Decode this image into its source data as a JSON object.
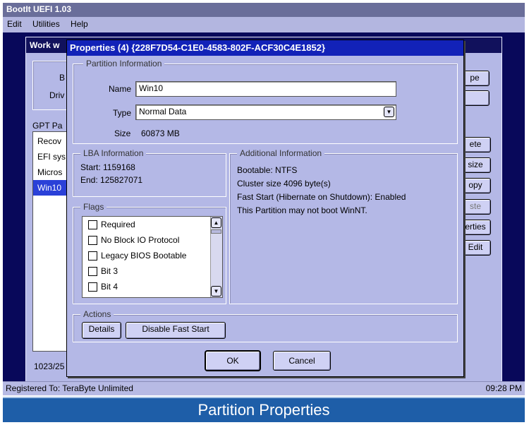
{
  "app": {
    "title": "BootIt UEFI 1.03",
    "menu": [
      "Edit",
      "Utilities",
      "Help"
    ]
  },
  "background": {
    "work_title": "Work w",
    "labels": [
      "B",
      "Driv"
    ],
    "gpt_label": "GPT Pa",
    "partitions": [
      "Recov",
      "EFI sys",
      "Micros",
      "Win10"
    ],
    "bottom_text": "1023/25",
    "right_buttons": [
      "pe",
      "",
      "ete",
      "size",
      "opy",
      "ste",
      "erties",
      "Edit"
    ]
  },
  "dialog": {
    "title": "Properties (4) {228F7D54-C1E0-4583-802F-ACF30C4E1852}",
    "partition_info_legend": "Partition Information",
    "name_label": "Name",
    "name_value": "Win10",
    "type_label": "Type",
    "type_value": "Normal Data",
    "size_label": "Size",
    "size_value": "60873 MB",
    "lba_legend": "LBA Information",
    "lba_start": "Start: 1159168",
    "lba_end": "End: 125827071",
    "additional_legend": "Additional Information",
    "additional_lines": [
      "Bootable: NTFS",
      "Cluster size 4096 byte(s)",
      "Fast Start (Hibernate on Shutdown): Enabled",
      "This Partition may not boot WinNT."
    ],
    "flags_legend": "Flags",
    "flags": [
      "Required",
      "No Block IO Protocol",
      "Legacy BIOS Bootable",
      "Bit 3",
      "Bit 4"
    ],
    "actions_legend": "Actions",
    "details_button": "Details",
    "disable_fast_start_button": "Disable Fast Start",
    "ok_button": "OK",
    "cancel_button": "Cancel"
  },
  "status_bar": {
    "registered": "Registered To: TeraByte Unlimited",
    "time": "09:28 PM"
  },
  "caption": "Partition Properties"
}
